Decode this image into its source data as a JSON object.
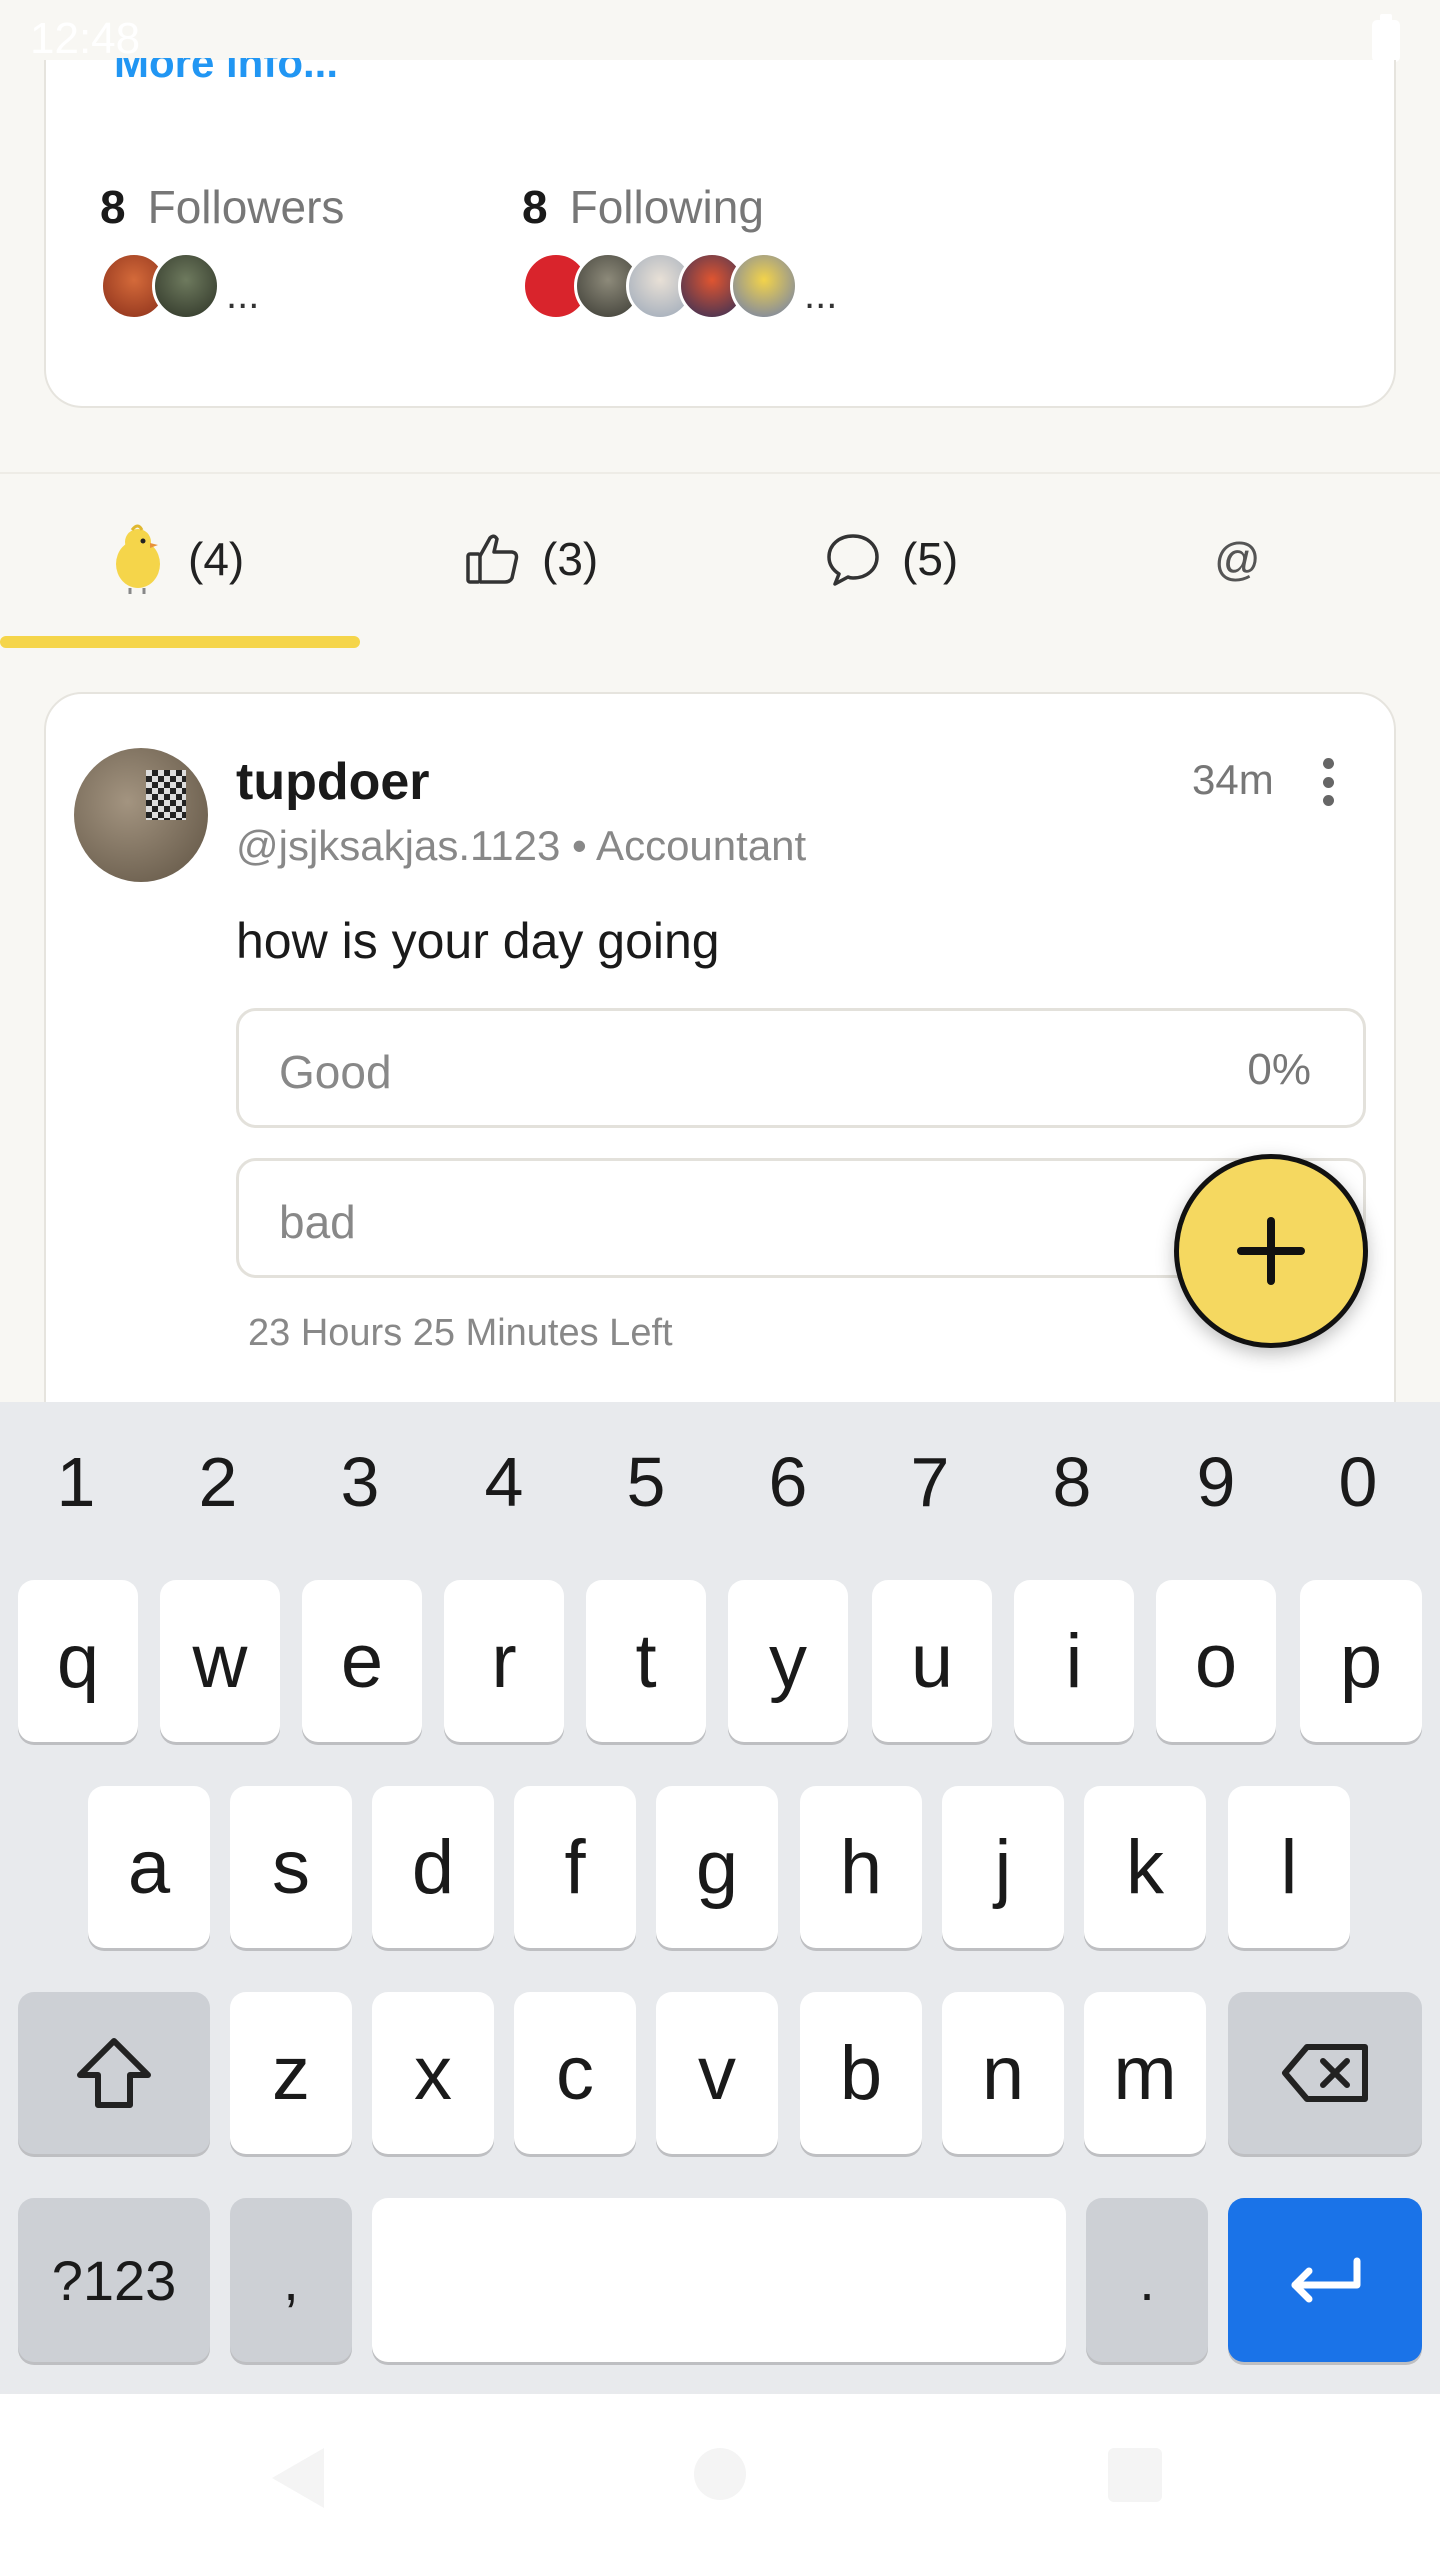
{
  "status_bar": {
    "time": "12:48"
  },
  "profile": {
    "more_info": "More info...",
    "followers": {
      "count": "8",
      "label": "Followers",
      "more": "..."
    },
    "following": {
      "count": "8",
      "label": "Following",
      "more": "..."
    }
  },
  "tabs": [
    {
      "icon": "chick-icon",
      "label": "(4)",
      "selected": true
    },
    {
      "icon": "thumbs-up-icon",
      "label": "(3)"
    },
    {
      "icon": "comment-icon",
      "label": "(5)"
    },
    {
      "icon": "at-icon",
      "label": "@"
    }
  ],
  "post": {
    "username": "tupdoer",
    "handle": "@jsjksakjas.1123 • Accountant",
    "time": "34m",
    "text": "how is your day going",
    "options": [
      {
        "label": "Good",
        "percent": "0%"
      },
      {
        "label": "bad",
        "percent": ""
      }
    ],
    "time_left": "23 Hours 25 Minutes Left"
  },
  "keyboard": {
    "numbers": [
      "1",
      "2",
      "3",
      "4",
      "5",
      "6",
      "7",
      "8",
      "9",
      "0"
    ],
    "row1": [
      "q",
      "w",
      "e",
      "r",
      "t",
      "y",
      "u",
      "i",
      "o",
      "p"
    ],
    "row2": [
      "a",
      "s",
      "d",
      "f",
      "g",
      "h",
      "j",
      "k",
      "l"
    ],
    "row3": [
      "z",
      "x",
      "c",
      "v",
      "b",
      "n",
      "m"
    ],
    "symbols_key": "?123",
    "comma": ",",
    "period": "."
  },
  "colors": {
    "accent_yellow": "#f5d54a",
    "link_blue": "#2196f3",
    "enter_blue": "#1a73e8"
  }
}
